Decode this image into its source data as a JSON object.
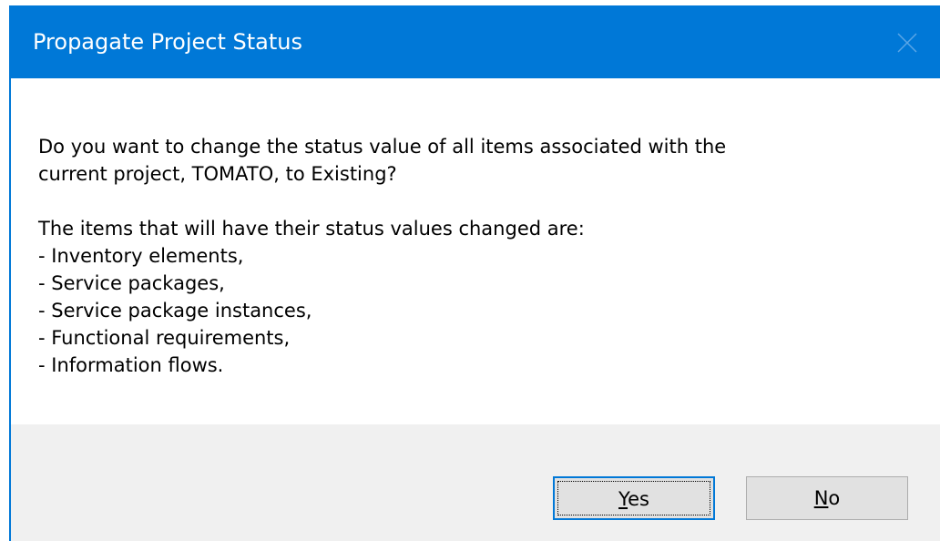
{
  "dialog": {
    "title": "Propagate Project Status",
    "close_icon": "close-icon",
    "colors": {
      "titlebar": "#0078d7",
      "footer": "#f0f0f0",
      "button": "#e1e1e1"
    }
  },
  "message": {
    "question_line1": "Do you want to change the status value of all items associated with the",
    "question_line2": "current project, TOMATO, to Existing?",
    "intro": "The items that will have their status values changed are:",
    "items": [
      "- Inventory elements,",
      "- Service packages,",
      "- Service package instances,",
      "- Functional requirements,",
      "- Information flows."
    ]
  },
  "buttons": {
    "yes": {
      "mnemonic": "Y",
      "rest": "es"
    },
    "no": {
      "mnemonic": "N",
      "rest": "o"
    }
  }
}
